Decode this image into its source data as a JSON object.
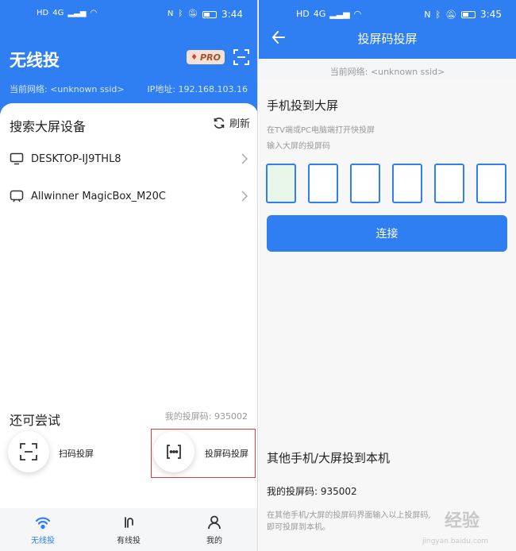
{
  "left_screen": {
    "status": {
      "hd": "HD",
      "network": "4G",
      "time": "3:44"
    },
    "app_title": "无线投",
    "pro_label": "PRO",
    "network_label": "当前网络: <unknown ssid>",
    "ip_label": "IP地址: 192.168.103.16",
    "section_title": "搜索大屏设备",
    "refresh_label": "刷新",
    "devices": [
      {
        "name": "DESKTOP-IJ9THL8",
        "icon": "monitor-icon"
      },
      {
        "name": "Allwinner MagicBox_M20C",
        "icon": "tv-icon"
      }
    ],
    "try_title": "还可尝试",
    "my_code": "我的投屏码: 935002",
    "options": [
      {
        "label": "扫码投屏",
        "icon": "scan-icon"
      },
      {
        "label": "投屏码投屏",
        "icon": "code-icon"
      }
    ],
    "tabs": [
      {
        "label": "无线投",
        "icon": "wifi-icon",
        "active": true
      },
      {
        "label": "有线投",
        "icon": "cable-icon",
        "active": false
      },
      {
        "label": "我的",
        "icon": "user-icon",
        "active": false
      }
    ]
  },
  "right_screen": {
    "status": {
      "hd": "HD",
      "network": "4G",
      "time": "3:45"
    },
    "title": "投屏码投屏",
    "network_label": "当前网络: <unknown ssid>",
    "heading": "手机投到大屏",
    "hint_line1": "在TV端或PC电脑端打开快投屏",
    "hint_line2": "输入大屏的投屏码",
    "code_boxes": [
      "",
      "",
      "",
      "",
      "",
      ""
    ],
    "connect_label": "连接",
    "heading2": "其他手机/大屏投到本机",
    "my_code": "我的投屏码: 935002",
    "desc_line1": "在其他手机/大屏的投屏码界面输入以上投屏码,",
    "desc_line2": "即可投屏到本机。",
    "watermark": "经验",
    "watermark_sub": "jingyan.baidu.com"
  },
  "colors": {
    "primary": "#2f7ff2",
    "highlight_box": "#e23b3b",
    "active_code_box": "#e8f6ea"
  }
}
